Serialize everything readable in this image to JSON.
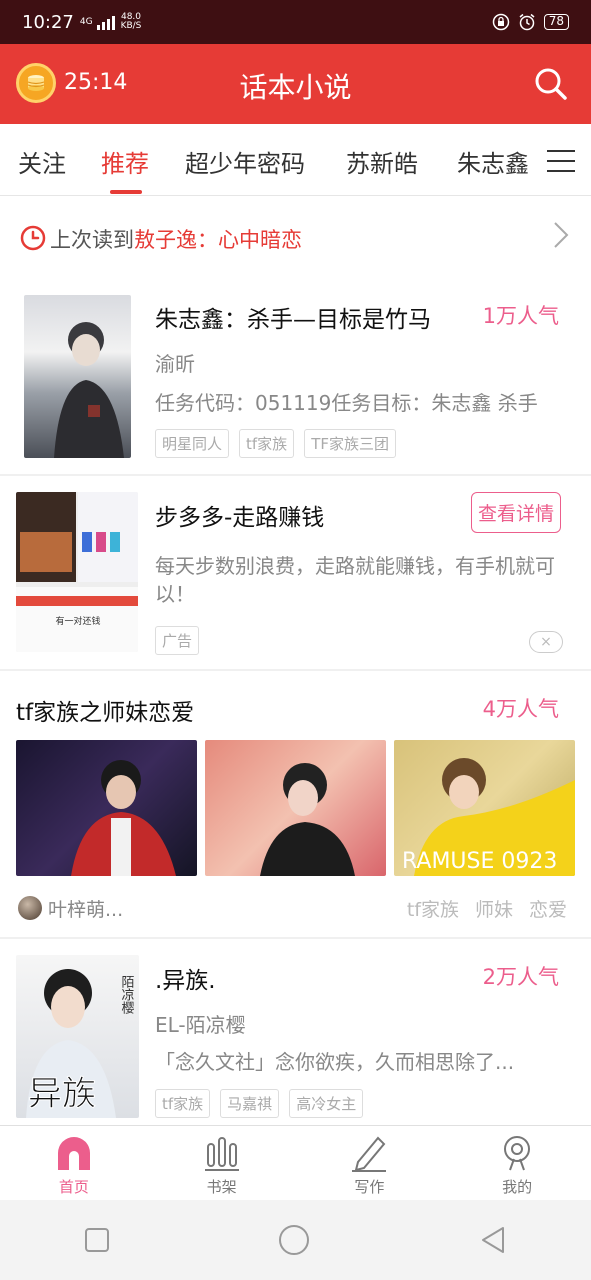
{
  "status_bar": {
    "time": "10:27",
    "network": "4G",
    "speed_value": "48.0",
    "speed_unit": "KB/S",
    "battery": "78"
  },
  "app_bar": {
    "timer": "25:14",
    "title": "话本小说",
    "coin_icon": "gold-coin-icon",
    "search_icon": "search-icon",
    "accent_color": "#e63b36"
  },
  "tabs": {
    "items": [
      "关注",
      "推荐",
      "超少年密码",
      "苏新皓",
      "朱志鑫"
    ],
    "active_index": 1,
    "menu_icon": "hamburger-icon"
  },
  "last_read": {
    "prefix": "上次读到",
    "book": "敖子逸：心中暗恋"
  },
  "feed": [
    {
      "title": "朱志鑫：杀手—目标是竹马",
      "popularity": "1万人气",
      "author": "渝昕",
      "description": "任务代码：051119任务目标：朱志鑫  杀手",
      "tags": [
        "明星同人",
        "tf家族",
        "TF家族三团"
      ]
    },
    {
      "title": "步多多-走路赚钱",
      "action": "查看详情",
      "description": "每天步数别浪费，走路就能赚钱，有手机就可以！",
      "ad_label": "广告",
      "close_symbol": "×",
      "cover_caption": "有一对还钱"
    },
    {
      "title": "tf家族之师妹恋爱",
      "popularity": "4万人气",
      "author": "叶梓萌...",
      "tags": [
        "tf家族",
        "师妹",
        "恋爱"
      ],
      "image_watermark": "RAMUSE 0923"
    },
    {
      "title": ".异族.",
      "popularity": "2万人气",
      "author": "EL-陌凉樱",
      "description": "「念久文社」念你欲疾，久而相思除了...",
      "tags": [
        "tf家族",
        "马嘉祺",
        "高冷女主"
      ],
      "cover_text": "异族",
      "cover_vertical_text": "陌凉樱"
    }
  ],
  "bottom_nav": [
    {
      "label": "首页",
      "icon": "home-icon",
      "active": true
    },
    {
      "label": "书架",
      "icon": "bookshelf-icon",
      "active": false
    },
    {
      "label": "写作",
      "icon": "pen-icon",
      "active": false
    },
    {
      "label": "我的",
      "icon": "profile-icon",
      "active": false
    }
  ],
  "colors": {
    "popularity": "#ec5e8c",
    "status_bar": "#3e0f12"
  }
}
